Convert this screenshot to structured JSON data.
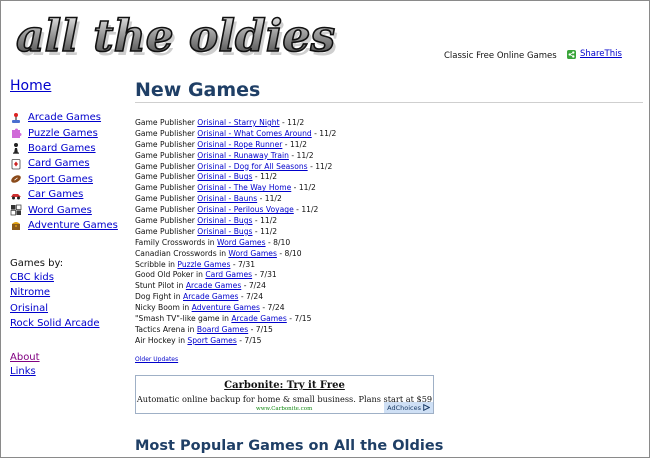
{
  "header": {
    "logo_text": "all the oldies",
    "tagline": "Classic Free Online Games",
    "share_label": "ShareThis"
  },
  "nav": {
    "home": "Home",
    "categories": [
      {
        "label": "Arcade Games",
        "icon": "arcade-joystick-icon",
        "color": "#4a6fd0"
      },
      {
        "label": "Puzzle Games",
        "icon": "puzzle-piece-icon",
        "color": "#d06ad8"
      },
      {
        "label": "Board Games",
        "icon": "chess-pawn-icon",
        "color": "#222222"
      },
      {
        "label": "Card Games",
        "icon": "playing-card-icon",
        "color": "#cc2222"
      },
      {
        "label": "Sport Games",
        "icon": "football-icon",
        "color": "#8a4a1a"
      },
      {
        "label": "Car Games",
        "icon": "race-car-icon",
        "color": "#d03030"
      },
      {
        "label": "Word Games",
        "icon": "letter-tiles-icon",
        "color": "#333333"
      },
      {
        "label": "Adventure Games",
        "icon": "treasure-icon",
        "color": "#e0a010"
      }
    ],
    "publishers_heading": "Games by:",
    "publishers": [
      "CBC kids",
      "Nitrome",
      "Orisinal",
      "Rock Solid Arcade"
    ],
    "about": "About",
    "links": "Links"
  },
  "main": {
    "title": "New Games",
    "updates": [
      {
        "prefix": "Game Publisher ",
        "link": "Orisinal - Starry Night",
        "suffix": " - 11/2"
      },
      {
        "prefix": "Game Publisher ",
        "link": "Orisinal - What Comes Around",
        "suffix": " - 11/2"
      },
      {
        "prefix": "Game Publisher ",
        "link": "Orisinal - Rope Runner",
        "suffix": " - 11/2"
      },
      {
        "prefix": "Game Publisher ",
        "link": "Orisinal - Runaway Train",
        "suffix": " - 11/2"
      },
      {
        "prefix": "Game Publisher ",
        "link": "Orisinal - Dog for All Seasons",
        "suffix": " - 11/2"
      },
      {
        "prefix": "Game Publisher ",
        "link": "Orisinal - Bugs",
        "suffix": " - 11/2"
      },
      {
        "prefix": "Game Publisher ",
        "link": "Orisinal - The Way Home",
        "suffix": " - 11/2"
      },
      {
        "prefix": "Game Publisher ",
        "link": "Orisinal - Bauns",
        "suffix": " - 11/2"
      },
      {
        "prefix": "Game Publisher ",
        "link": "Orisinal - Perilous Voyage",
        "suffix": " - 11/2"
      },
      {
        "prefix": "Game Publisher ",
        "link": "Orisinal - Bugs",
        "suffix": " - 11/2"
      },
      {
        "prefix": "Game Publisher ",
        "link": "Orisinal - Bugs",
        "suffix": " - 11/2"
      },
      {
        "prefix": "Family Crosswords in ",
        "link": "Word Games",
        "suffix": " - 8/10"
      },
      {
        "prefix": "Canadian Crosswords in ",
        "link": "Word Games",
        "suffix": " - 8/10"
      },
      {
        "prefix": "Scribble in ",
        "link": "Puzzle Games",
        "suffix": " - 7/31"
      },
      {
        "prefix": "Good Old Poker in ",
        "link": "Card Games",
        "suffix": " - 7/31"
      },
      {
        "prefix": "Stunt Pilot in ",
        "link": "Arcade Games",
        "suffix": " - 7/24"
      },
      {
        "prefix": "Dog Fight in ",
        "link": "Arcade Games",
        "suffix": " - 7/24"
      },
      {
        "prefix": "Nicky Boom in ",
        "link": "Adventure Games",
        "suffix": " - 7/24"
      },
      {
        "prefix": "\"Smash TV\"-like game in ",
        "link": "Arcade Games",
        "suffix": " - 7/15"
      },
      {
        "prefix": "Tactics Arena in ",
        "link": "Board Games",
        "suffix": " - 7/15"
      },
      {
        "prefix": "Air Hockey in ",
        "link": "Sport Games",
        "suffix": " - 7/15"
      }
    ],
    "older_updates": "Older Updates",
    "ad": {
      "title": "Carbonite: Try it Free",
      "text": "Automatic online backup for home & small business. Plans start at $59",
      "url": "www.Carbonite.com",
      "adchoices": "AdChoices"
    },
    "popular_title": "Most Popular Games on All the Oldies"
  }
}
